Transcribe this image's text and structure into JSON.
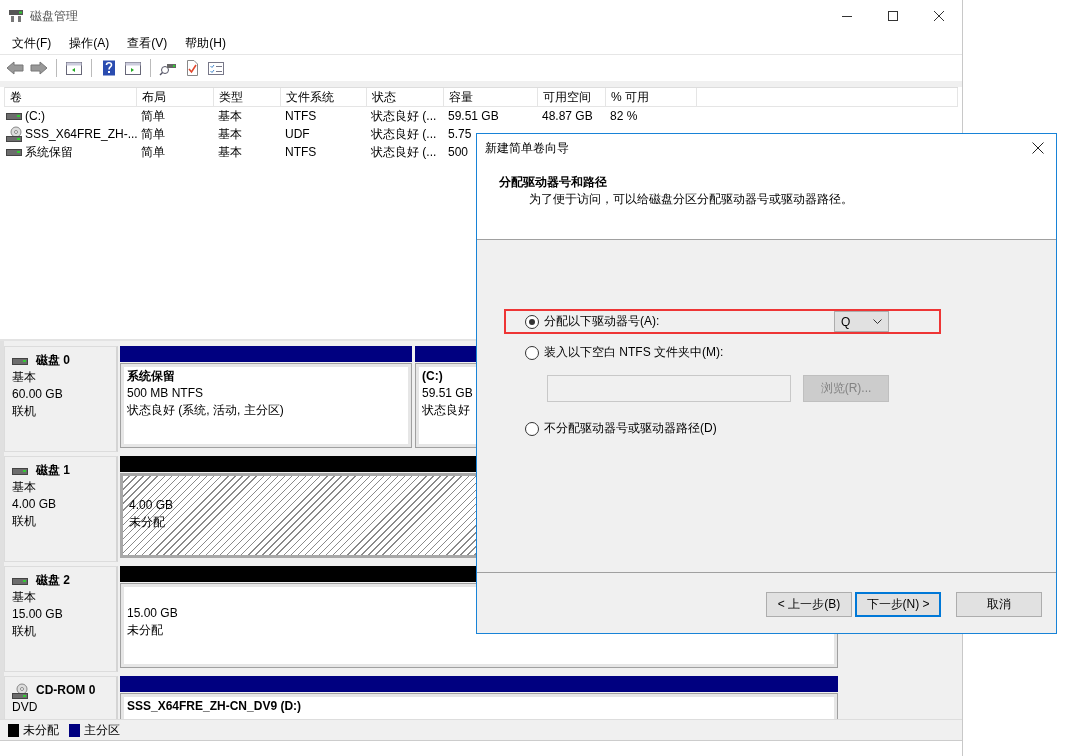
{
  "window": {
    "title": "磁盘管理"
  },
  "menu": [
    "文件(F)",
    "操作(A)",
    "查看(V)",
    "帮助(H)"
  ],
  "volume_table": {
    "columns": [
      "卷",
      "布局",
      "类型",
      "文件系统",
      "状态",
      "容量",
      "可用空间",
      "% 可用"
    ],
    "rows": [
      {
        "kind": "disk",
        "cells": [
          "(C:)",
          "简单",
          "基本",
          "NTFS",
          "状态良好 (...",
          "59.51 GB",
          "48.87 GB",
          "82 %"
        ]
      },
      {
        "kind": "optical",
        "cells": [
          "SSS_X64FRE_ZH-...",
          "简单",
          "基本",
          "UDF",
          "状态良好 (...",
          "5.75"
        ]
      },
      {
        "kind": "disk",
        "cells": [
          "系统保留",
          "简单",
          "基本",
          "NTFS",
          "状态良好 (...",
          "500"
        ]
      }
    ]
  },
  "disks": [
    {
      "kind": "disk",
      "name": "磁盘 0",
      "type": "基本",
      "size": "60.00 GB",
      "status": "联机",
      "partitions": [
        {
          "kind": "primary",
          "selected": false,
          "title": "系统保留",
          "size": "500 MB NTFS",
          "status": "状态良好 (系统, 活动, 主分区)"
        },
        {
          "kind": "primary",
          "selected": false,
          "title": "(C:)",
          "size": "59.51 GB",
          "status": "状态良好"
        }
      ]
    },
    {
      "kind": "disk",
      "name": "磁盘 1",
      "type": "基本",
      "size": "4.00 GB",
      "status": "联机",
      "partitions": [
        {
          "kind": "unallocated",
          "selected": true,
          "size": "4.00 GB",
          "status": "未分配"
        }
      ]
    },
    {
      "kind": "disk",
      "name": "磁盘 2",
      "type": "基本",
      "size": "15.00 GB",
      "status": "联机",
      "partitions": [
        {
          "kind": "unallocated",
          "selected": false,
          "size": "15.00 GB",
          "status": "未分配"
        }
      ]
    },
    {
      "kind": "optical",
      "name": "CD-ROM 0",
      "type": "DVD",
      "partitions": [
        {
          "kind": "primary",
          "selected": false,
          "title": "SSS_X64FRE_ZH-CN_DV9  (D:)"
        }
      ]
    }
  ],
  "legend": [
    {
      "label": "未分配",
      "color": "#000000"
    },
    {
      "label": "主分区",
      "color": "#000080"
    }
  ],
  "wizard": {
    "title": "新建简单卷向导",
    "heading": "分配驱动器号和路径",
    "description": "为了便于访问，可以给磁盘分区分配驱动器号或驱动器路径。",
    "options": [
      {
        "label": "分配以下驱动器号(A):",
        "selected": true,
        "highlighted": true
      },
      {
        "label": "装入以下空白 NTFS 文件夹中(M):",
        "selected": false,
        "highlighted": false
      },
      {
        "label": "不分配驱动器号或驱动器路径(D)",
        "selected": false,
        "highlighted": false
      }
    ],
    "drive_letter": "Q",
    "folder_field": {
      "disabled": true
    },
    "browse_button": {
      "label": "浏览(R)...",
      "disabled": true
    },
    "buttons": [
      {
        "label": "< 上一步(B)",
        "focused": false
      },
      {
        "label": "下一步(N) >",
        "focused": true
      },
      {
        "label": "取消",
        "focused": false
      }
    ]
  }
}
